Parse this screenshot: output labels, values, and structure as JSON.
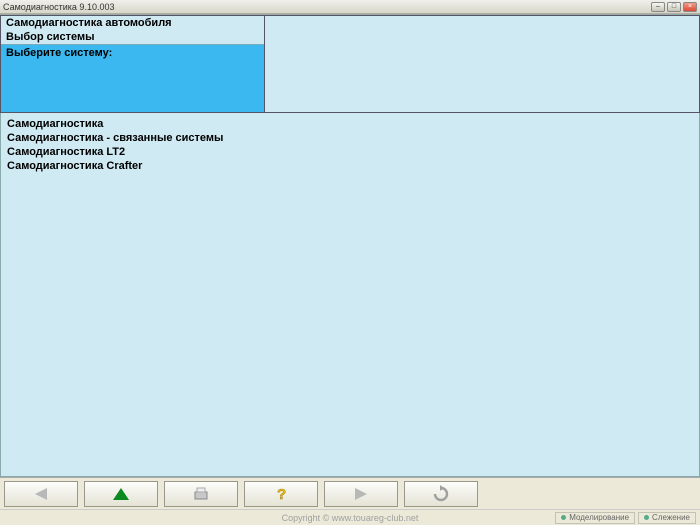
{
  "window": {
    "title": "Самодиагностика 9.10.003"
  },
  "header": {
    "line1": "Самодиагностика автомобиля",
    "line2": "Выбор системы",
    "prompt": "Выберите систему:"
  },
  "list": {
    "items": [
      {
        "label": "Самодиагностика"
      },
      {
        "label": "Самодиагностика - связанные системы"
      },
      {
        "label": "Самодиагностика LT2"
      },
      {
        "label": "Самодиагностика Crafter"
      }
    ]
  },
  "status": {
    "copyright": "Copyright © www.touareg-club.net",
    "cell1": "Моделирование",
    "cell2": "Слежение"
  }
}
